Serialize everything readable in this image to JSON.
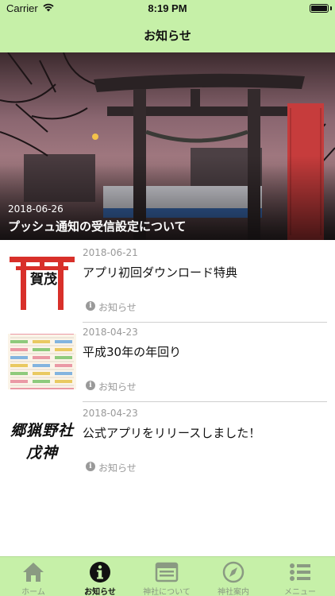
{
  "status_bar": {
    "carrier": "Carrier",
    "time": "8:19 PM"
  },
  "nav": {
    "title": "お知らせ"
  },
  "featured": {
    "date": "2018-06-26",
    "title": "プッシュ通知の受信設定について"
  },
  "news": [
    {
      "date": "2018-06-21",
      "title": "アプリ初回ダウンロード特典",
      "category": "お知らせ",
      "thumb_text": "賀茂"
    },
    {
      "date": "2018-04-23",
      "title": "平成30年の年回り",
      "category": "お知らせ"
    },
    {
      "date": "2018-04-23",
      "title": "公式アプリをリリースしました！",
      "category": "お知らせ",
      "thumb_text": "郷猟野社 戊神"
    }
  ],
  "tabs": [
    {
      "label": "ホーム",
      "icon": "home-icon"
    },
    {
      "label": "お知らせ",
      "icon": "info-icon"
    },
    {
      "label": "神社について",
      "icon": "shrine-info-icon"
    },
    {
      "label": "神社案内",
      "icon": "compass-icon"
    },
    {
      "label": "メニュー",
      "icon": "menu-list-icon"
    }
  ],
  "colors": {
    "bar_background": "#c6f0a8",
    "tab_active": "#111111",
    "tab_inactive": "#8a9a82",
    "meta_gray": "#999999"
  }
}
